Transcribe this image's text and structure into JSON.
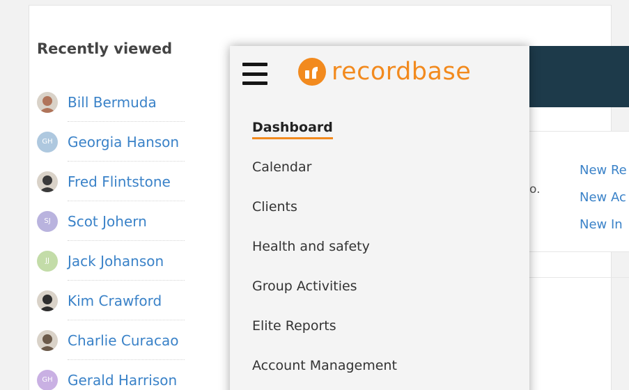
{
  "recently_viewed": {
    "title": "Recently viewed",
    "items": [
      {
        "name": "Bill Bermuda",
        "avatar_type": "photo",
        "photo_color": "#b0745a"
      },
      {
        "name": "Georgia Hanson",
        "avatar_type": "initials",
        "initials": "GH",
        "color": "#aec8df"
      },
      {
        "name": "Fred Flintstone",
        "avatar_type": "photo",
        "photo_color": "#3a3a3a"
      },
      {
        "name": "Scot Johern",
        "avatar_type": "initials",
        "initials": "SJ",
        "color": "#b9b3de"
      },
      {
        "name": "Jack Johanson",
        "avatar_type": "initials",
        "initials": "JJ",
        "color": "#c3dca8"
      },
      {
        "name": "Kim Crawford",
        "avatar_type": "photo",
        "photo_color": "#2e2e2e"
      },
      {
        "name": "Charlie Curacao",
        "avatar_type": "photo",
        "photo_color": "#6b5a4a"
      },
      {
        "name": "Gerald Harrison",
        "avatar_type": "initials",
        "initials": "GH",
        "color": "#c9b0e3"
      }
    ]
  },
  "drawer": {
    "menu_icon": "hamburger-icon",
    "logo_text": "recordbase",
    "brand_color": "#f28a1e",
    "nav_items": [
      {
        "label": "Dashboard",
        "active": true
      },
      {
        "label": "Calendar",
        "active": false
      },
      {
        "label": "Clients",
        "active": false
      },
      {
        "label": "Health and safety",
        "active": false
      },
      {
        "label": "Group Activities",
        "active": false
      },
      {
        "label": "Elite Reports",
        "active": false
      },
      {
        "label": "Account Management",
        "active": false
      }
    ]
  },
  "right_panel": {
    "fragment_text": "o.",
    "links": [
      "New Re",
      "New Ac",
      "New In"
    ]
  }
}
